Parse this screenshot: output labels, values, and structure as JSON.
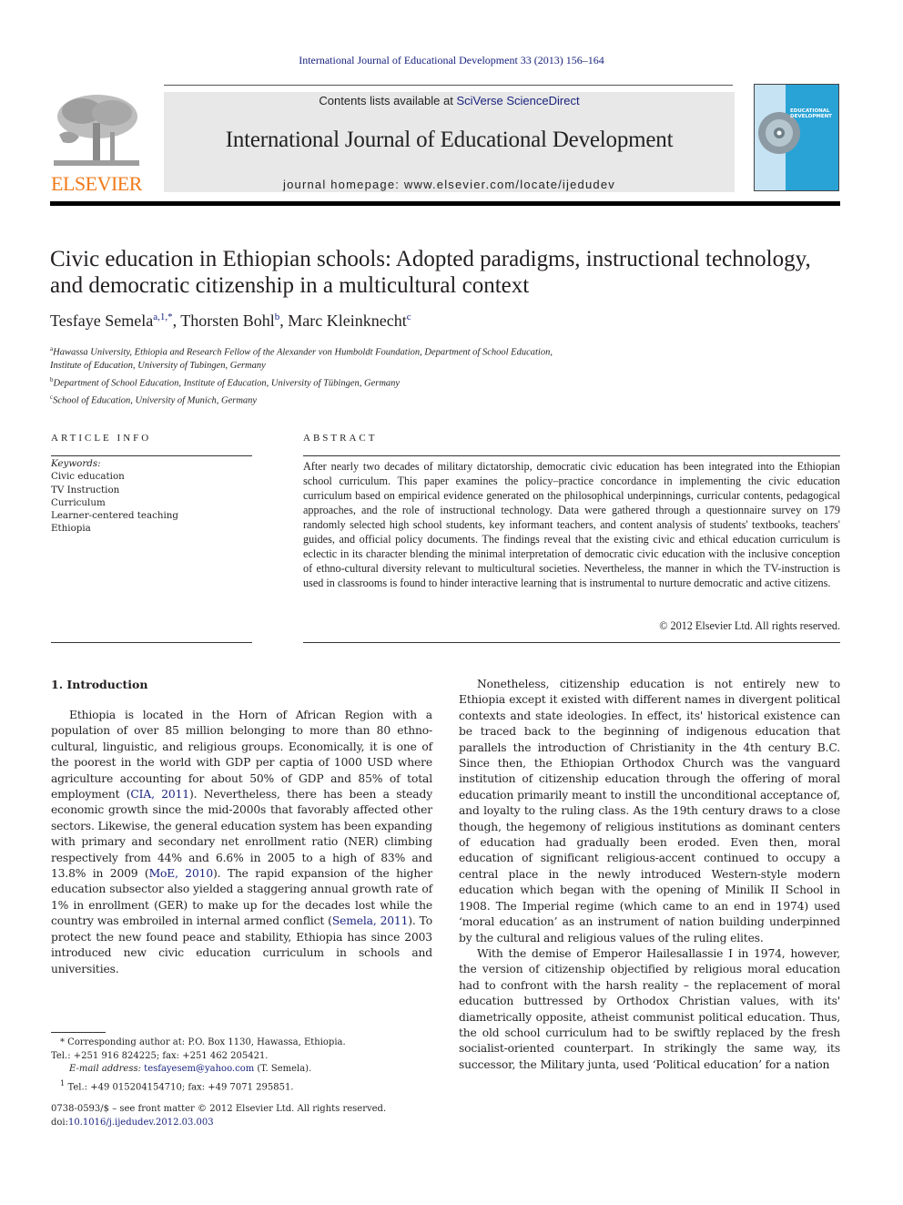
{
  "header": {
    "citation": "International Journal of Educational Development 33 (2013) 156–164",
    "publisher_logo_label": "ELSEVIER",
    "contents_prefix": "Contents lists available at ",
    "contents_link": "SciVerse ScienceDirect",
    "journal_name": "International Journal of Educational Development",
    "homepage": "journal homepage: www.elsevier.com/locate/ijedudev",
    "cover_title_line1": "EDUCATIONAL",
    "cover_title_line2": "DEVELOPMENT",
    "colors": {
      "link": "#1a237e",
      "elsevier_orange": "#f07a1a",
      "cover_blue": "#29a3d6",
      "banner_gray": "#e8e8e8"
    }
  },
  "article": {
    "title": "Civic education in Ethiopian schools: Adopted paradigms, instructional technology, and democratic citizenship in a multicultural context",
    "authors": [
      {
        "name": "Tesfaye Semela",
        "marks": "a,1,*"
      },
      {
        "name": "Thorsten Bohl",
        "marks": "b"
      },
      {
        "name": "Marc Kleinknecht",
        "marks": "c"
      }
    ],
    "affiliations": [
      {
        "mark": "a",
        "text": "Hawassa University, Ethiopia and Research Fellow of the Alexander von Humboldt Foundation, Department of School Education,",
        "cont": "Institute of Education, University of Tubingen, Germany"
      },
      {
        "mark": "b",
        "text": "Department of School Education, Institute of Education, University of Tübingen, Germany"
      },
      {
        "mark": "c",
        "text": "School of Education, University of Munich, Germany"
      }
    ]
  },
  "article_info": {
    "heading": "ARTICLE INFO",
    "keywords_label": "Keywords:",
    "keywords": [
      "Civic education",
      "TV Instruction",
      "Curriculum",
      "Learner-centered teaching",
      "Ethiopia"
    ]
  },
  "abstract": {
    "heading": "ABSTRACT",
    "text": "After nearly two decades of military dictatorship, democratic civic education has been integrated into the Ethiopian school curriculum. This paper examines the policy–practice concordance in implementing the civic education curriculum based on empirical evidence generated on the philosophical underpinnings, curricular contents, pedagogical approaches, and the role of instructional technology. Data were gathered through a questionnaire survey on 179 randomly selected high school students, key informant teachers, and content analysis of students' textbooks, teachers' guides, and official policy documents. The findings reveal that the existing civic and ethical education curriculum is eclectic in its character blending the minimal interpretation of democratic civic education with the inclusive conception of ethno-cultural diversity relevant to multicultural societies. Nevertheless, the manner in which the TV-instruction is used in classrooms is found to hinder interactive learning that is instrumental to nurture democratic and active citizens.",
    "copyright": "© 2012 Elsevier Ltd. All rights reserved."
  },
  "body": {
    "section_heading": "1.  Introduction",
    "left_paragraph": {
      "t1": "Ethiopia is located in the Horn of African Region with a population of over 85 million belonging to more than 80 ethno-cultural, linguistic, and religious groups. Economically, it is one of the poorest in the world with GDP per captia of 1000 USD where agriculture accounting for about 50% of GDP and 85% of total employment (",
      "ref1": "CIA, 2011",
      "t2": "). Nevertheless, there has been a steady economic growth since the mid-2000s that favorably affected other sectors. Likewise, the general education system has been expanding with primary and secondary net enrollment ratio (NER) climbing respectively from 44% and 6.6% in 2005 to a high of 83% and 13.8% in 2009 (",
      "ref2": "MoE, 2010",
      "t3": "). The rapid expansion of the higher education subsector also yielded a staggering annual growth rate of 1% in enrollment (GER) to make up for the decades lost while the country was embroiled in internal armed conflict (",
      "ref3": "Semela, 2011",
      "t4": "). To protect the new found peace and stability, Ethiopia has since 2003 introduced new civic education curriculum in schools and universities."
    },
    "right_paragraphs": [
      "Nonetheless, citizenship education is not entirely new to Ethiopia except it existed with different names in divergent political contexts and state ideologies. In effect, its' historical existence can be traced back to the beginning of indigenous education that parallels the introduction of Christianity in the 4th century B.C. Since then, the Ethiopian Orthodox Church was the vanguard institution of citizenship education through the offering of moral education primarily meant to instill the unconditional acceptance of, and loyalty to the ruling class. As the 19th century draws to a close though, the hegemony of religious institutions as dominant centers of education had gradually been eroded. Even then, moral education of significant religious-accent continued to occupy a central place in the newly introduced Western-style modern education which began with the opening of Minilik II School in 1908. The Imperial regime (which came to an end in 1974) used ‘moral education’ as an instrument of nation building underpinned by the cultural and religious values of the ruling elites.",
      "With the demise of Emperor Hailesallassie I in 1974, however, the version of citizenship objectified by religious moral education had to confront with the harsh reality – the replacement of moral education buttressed by Orthodox Christian values, with its' diametrically opposite, atheist communist political education. Thus, the old school curriculum had to be swiftly replaced by the fresh socialist-oriented counterpart. In strikingly the same way, its successor, the Military junta, used ‘Political education’ for a nation"
    ]
  },
  "footnotes": {
    "corresponding": "* Corresponding author at: P.O. Box 1130, Hawassa, Ethiopia.",
    "tel": "Tel.: +251 916 824225; fax: +251 462 205421.",
    "email_label": "E-mail address: ",
    "email": "tesfayesem@yahoo.com",
    "email_suffix": " (T. Semela).",
    "fn1_mark": "1",
    "fn1": " Tel.: +49 015204154710; fax: +49 7071 295851.",
    "front_matter": "0738-0593/$ – see front matter © 2012 Elsevier Ltd. All rights reserved.",
    "doi_label": "doi:",
    "doi": "10.1016/j.ijedudev.2012.03.003"
  }
}
